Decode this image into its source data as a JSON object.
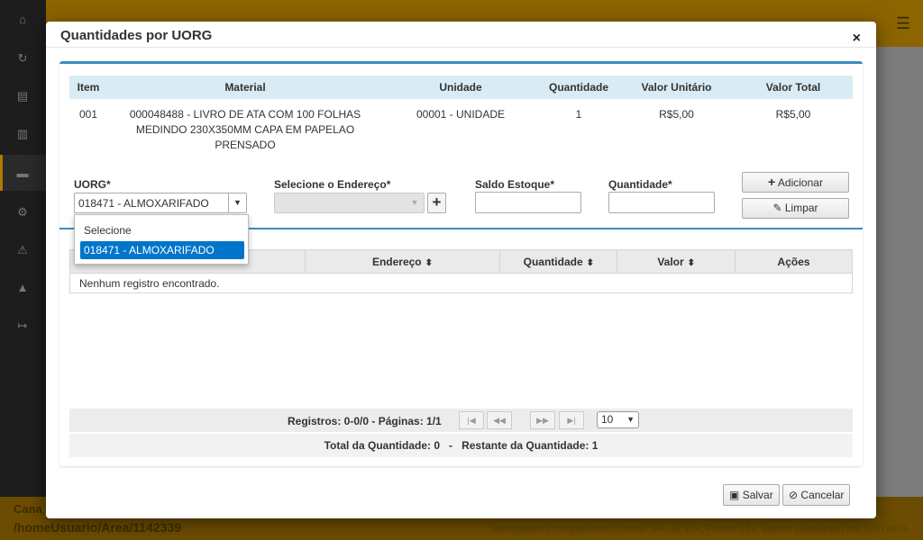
{
  "background": {
    "sidebar_icons": [
      "home-icon",
      "refresh-icon",
      "document-icon",
      "barcode-icon",
      "archive-icon",
      "cogs-icon",
      "warning-icon",
      "graduation-icon",
      "logout-icon"
    ],
    "footer_title": "Cana",
    "footer_path": "/homeUsuario/Area/1142339",
    "footer_compat": "Navegadores compatíveis: Chrome 34+, IE 10+, Firefox 23+. Melhor visualizado em 1551x826"
  },
  "modal": {
    "title": "Quantidades por UORG",
    "close_symbol": "×"
  },
  "items_table": {
    "headers": [
      "Item",
      "Material",
      "Unidade",
      "Quantidade",
      "Valor Unitário",
      "Valor Total"
    ],
    "row": {
      "item": "001",
      "material": "000048488 - LIVRO DE ATA COM 100 FOLHAS MEDINDO 230X350MM CAPA EM PAPELAO PRENSADO",
      "unidade": "00001 - UNIDADE",
      "quantidade": "1",
      "valor_unitario": "R$5,00",
      "valor_total": "R$5,00"
    }
  },
  "form": {
    "uorg_label": "UORG*",
    "uorg_value": "018471 - ALMOXARIFADO",
    "endereco_label": "Selecione o Endereço*",
    "saldo_label": "Saldo Estoque*",
    "quantidade_label": "Quantidade*",
    "adicionar_label": "Adicionar",
    "limpar_label": "Limpar",
    "dropdown_options": [
      "Selecione",
      "018471 - ALMOXARIFADO"
    ]
  },
  "grid": {
    "headers": [
      "",
      "Endereço",
      "Quantidade",
      "Valor",
      "Ações"
    ],
    "empty_message": "Nenhum registro encontrado."
  },
  "pager": {
    "info": "Registros: 0-0/0 - Páginas: 1/1",
    "rows_per_page": "10"
  },
  "totals": {
    "total_label": "Total da Quantidade: 0",
    "separator": "-",
    "restante_label": "Restante da Quantidade: 1"
  },
  "footer": {
    "salvar_label": "Salvar",
    "cancelar_label": "Cancelar"
  }
}
